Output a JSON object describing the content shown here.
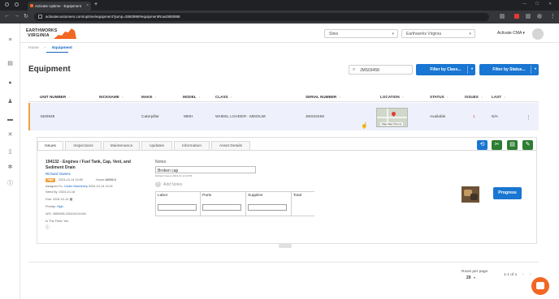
{
  "browser": {
    "tab_title": "Activate Uptime - Equipment",
    "url": "activatecustomers.com/uptime/equipment?jump=2850998#equipmentRow2850998"
  },
  "header": {
    "logo_line1": "EARTHWORKS",
    "logo_line2": "VIRGINIA",
    "sites_select": "Sites",
    "site_value": "Earthworks Virginia",
    "user_name": "Activate CMA"
  },
  "breadcrumb": {
    "home": "Home",
    "current": "Equipment"
  },
  "page": {
    "title": "Equipment",
    "search_value": "JMS03458",
    "filter_class": "Filter by Class...",
    "filter_status": "Filter by Status..."
  },
  "table": {
    "headers": [
      "UNIT NUMBER",
      "NICKNAME",
      "MAKE",
      "MODEL",
      "CLASS",
      "SERIAL NUMBER",
      "LOCATION",
      "STATUS",
      "ISSUES",
      "LAST"
    ],
    "row": {
      "unit": "M20848",
      "nickname": "",
      "make": "Caterpillar",
      "model": "980H",
      "class": "WHEEL LOADER - MEDIUM",
      "serial": "JMS03458",
      "location_label": "Map Data ©Terms",
      "status": "Available",
      "issues": "1",
      "last": "N/A"
    }
  },
  "detail": {
    "tabs": [
      "Issues",
      "Inspections",
      "Maintenance",
      "Updates",
      "Information",
      "Asset Details"
    ],
    "issue": {
      "title": "194132 - Engines / Fuel Tank, Cap, Vent, and Sediment Drain",
      "reporter": "Richard Owens",
      "badge": "High",
      "date": "2024-10-14 10:59",
      "hours_label": "Hours:",
      "hours": "14052.0",
      "assigned_label": "Assigned To:",
      "assigned": "Carter Machinery",
      "assigned_date": "2024-10-14 11:04",
      "need_by_label": "Need By:",
      "need_by": "2024-10-18",
      "due_label": "Due:",
      "due": "2024-10-14",
      "priority_label": "Priority:",
      "priority": "High",
      "wo_label": "WO:",
      "wo": "2850998-202410141004",
      "field_label": "In The Field:",
      "field": "Yes"
    },
    "notes_label": "Notes:",
    "notes_value": "Broken cap",
    "notes_sub": "Richard Owens 2024-10-14 10:59",
    "add_notes": "Add Notes",
    "grid_headers": [
      "Labor",
      "Parts",
      "Supplies",
      "Total"
    ],
    "progress_label": "Progress"
  },
  "footer": {
    "rows_per_page_label": "Rows per page",
    "rows_per_page": "20",
    "range": "1-1 of 1"
  }
}
